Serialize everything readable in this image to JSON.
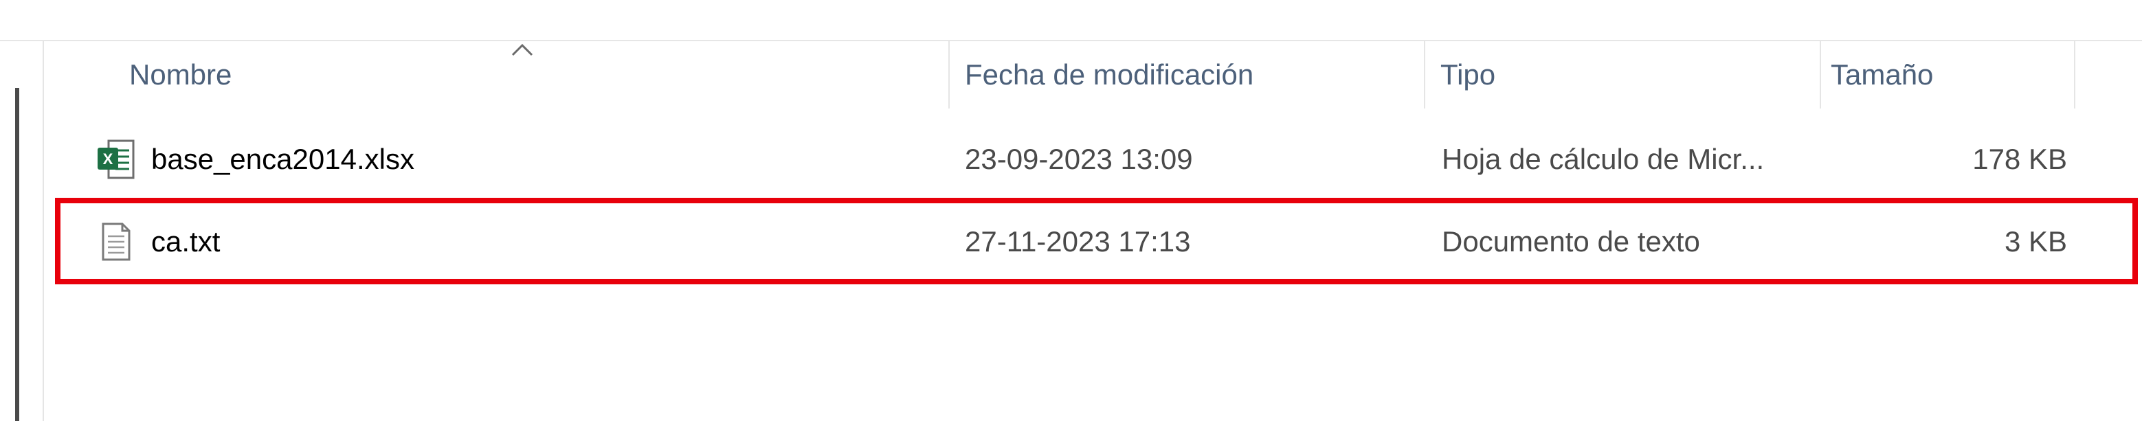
{
  "columns": {
    "name": "Nombre",
    "modified": "Fecha de modificación",
    "type": "Tipo",
    "size": "Tamaño"
  },
  "files": [
    {
      "name": "base_enca2014.xlsx",
      "modified": "23-09-2023 13:09",
      "type": "Hoja de cálculo de Micr...",
      "size": "178 KB",
      "icon": "excel-file-icon"
    },
    {
      "name": "ca.txt",
      "modified": "27-11-2023 17:13",
      "type": "Documento de texto",
      "size": "3 KB",
      "icon": "text-file-icon",
      "highlighted": true
    }
  ],
  "colors": {
    "highlight_border": "#e8000b",
    "excel_green": "#1d7044",
    "header_text": "#4c607a"
  }
}
